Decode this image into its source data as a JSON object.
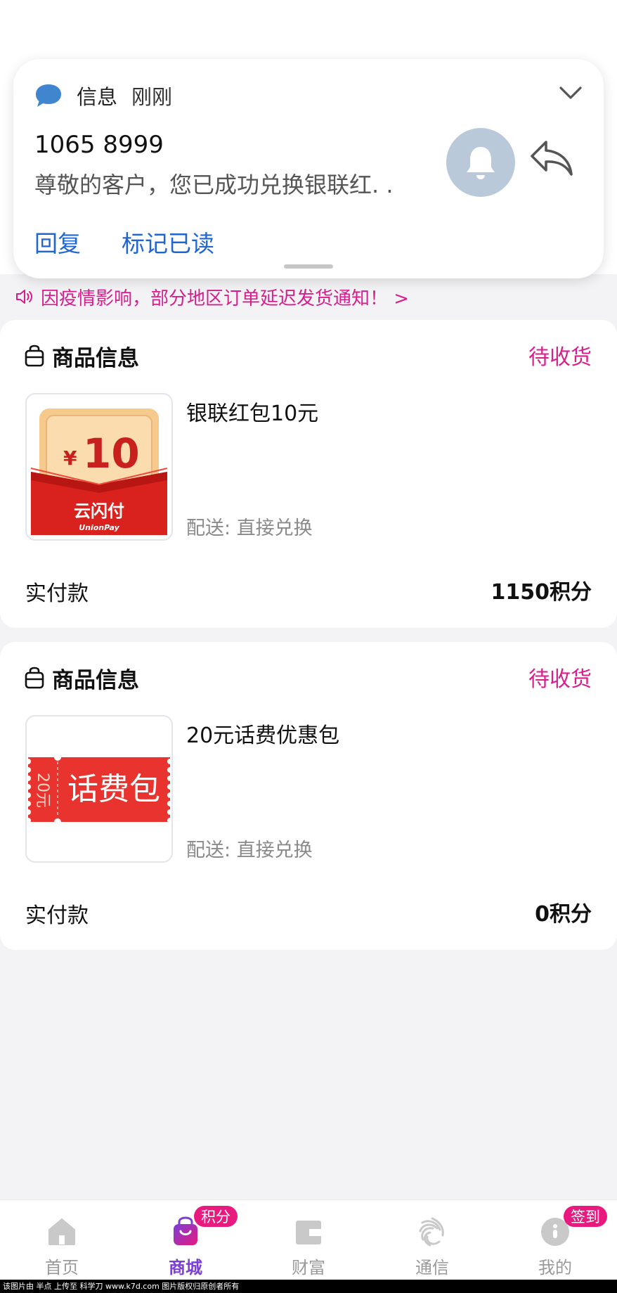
{
  "notification": {
    "app_name": "信息",
    "time": "刚刚",
    "sender": "1065 8999",
    "body": "尊敬的客户，您已成功兑换银联红. .",
    "actions": [
      "回复",
      "标记已读"
    ]
  },
  "notice": {
    "text": "因疫情影响，部分地区订单延迟发货通知！ >"
  },
  "orders": [
    {
      "section_title": "商品信息",
      "status": "待收货",
      "product_name": "银联红包10元",
      "delivery": "配送: 直接兑换",
      "pay_label": "实付款",
      "pay_value": "1150积分",
      "thumb": {
        "amount": "10",
        "currency": "¥",
        "brand": "云闪付",
        "brand_sub": "UnionPay"
      }
    },
    {
      "section_title": "商品信息",
      "status": "待收货",
      "product_name": "20元话费优惠包",
      "delivery": "配送: 直接兑换",
      "pay_label": "实付款",
      "pay_value": "0积分",
      "thumb": {
        "side_text": "20元",
        "main_text": "话费包"
      }
    }
  ],
  "tabbar": {
    "items": [
      {
        "label": "首页",
        "icon": "home-icon",
        "active": false
      },
      {
        "label": "商城",
        "icon": "shopping-bag-icon",
        "active": true,
        "badge": "积分"
      },
      {
        "label": "财富",
        "icon": "wallet-icon",
        "active": false
      },
      {
        "label": "通信",
        "icon": "mobile-network-icon",
        "active": false
      },
      {
        "label": "我的",
        "icon": "profile-icon",
        "active": false,
        "badge": "签到"
      }
    ]
  },
  "watermark": "该图片由 半点 上传至 科学刀 www.k7d.com 图片版权归原创者所有",
  "colors": {
    "accent": "#d81e8c",
    "link_blue": "#1f66d1",
    "tab_active": "#7b3fd6",
    "badge": "#e8197f"
  }
}
